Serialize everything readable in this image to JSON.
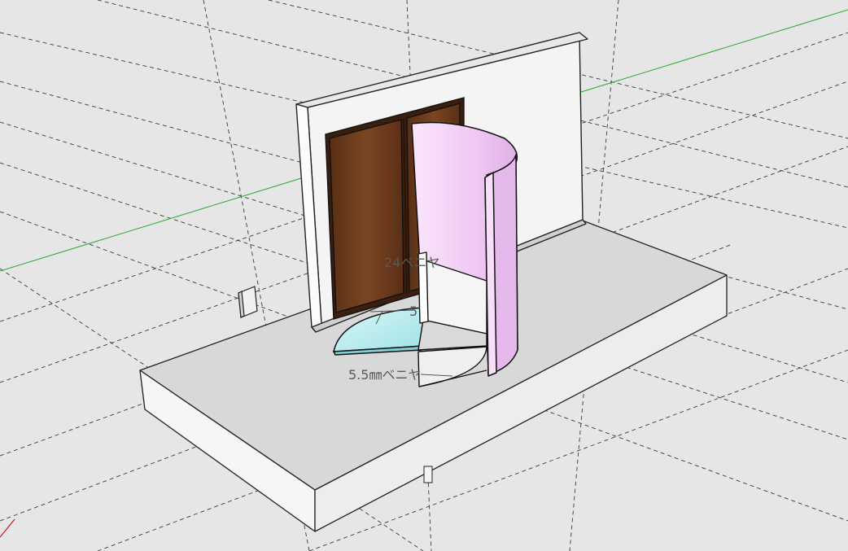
{
  "scene": {
    "colors": {
      "background": "#e6e6e6",
      "guide_line": "#3a3a3a",
      "green_axis": "#2ea82e",
      "red_axis": "#c00000",
      "face_light": "#f4f4f4",
      "face_top": "#d8d8d8",
      "face_side": "#ececec",
      "door_wood": "#6b3a1c",
      "door_wood_dark": "#4e2812",
      "curved_panel": "#f2cef5",
      "curved_panel_edge": "#c99ad1",
      "glass": "#b9eef0"
    },
    "labels": {
      "upper": "24ベニヤ",
      "middle": "5",
      "lower": "5.5㎜ベニヤ"
    }
  }
}
